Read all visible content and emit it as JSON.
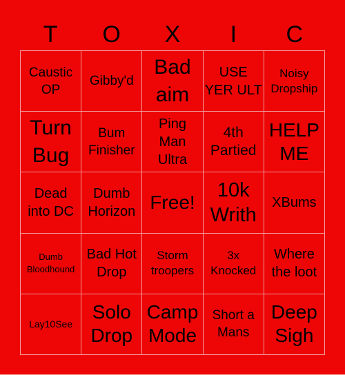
{
  "title_letters": [
    "T",
    "O",
    "X",
    "I",
    "C"
  ],
  "colors": {
    "background": "#ee0606",
    "grid_line": "#f39a9a",
    "text": "#000000"
  },
  "board": {
    "rows": [
      [
        "Caustic OP",
        "Gibby'd",
        "Bad aim",
        "USE YER ULT",
        "Noisy Dropship"
      ],
      [
        "Turn Bug",
        "Bum Finisher",
        "Ping Man Ultra",
        "4th Partied",
        "HELP ME"
      ],
      [
        "Dead into DC",
        "Dumb Horizon",
        "Free!",
        "10k Writh",
        "XBums"
      ],
      [
        "Dumb Bloodhound",
        "Bad Hot Drop",
        "Storm troopers",
        "3x Knocked",
        "Where the loot"
      ],
      [
        "Lay10See",
        "Solo Drop",
        "Camp Mode",
        "Short a Mans",
        "Deep Sigh"
      ]
    ]
  }
}
